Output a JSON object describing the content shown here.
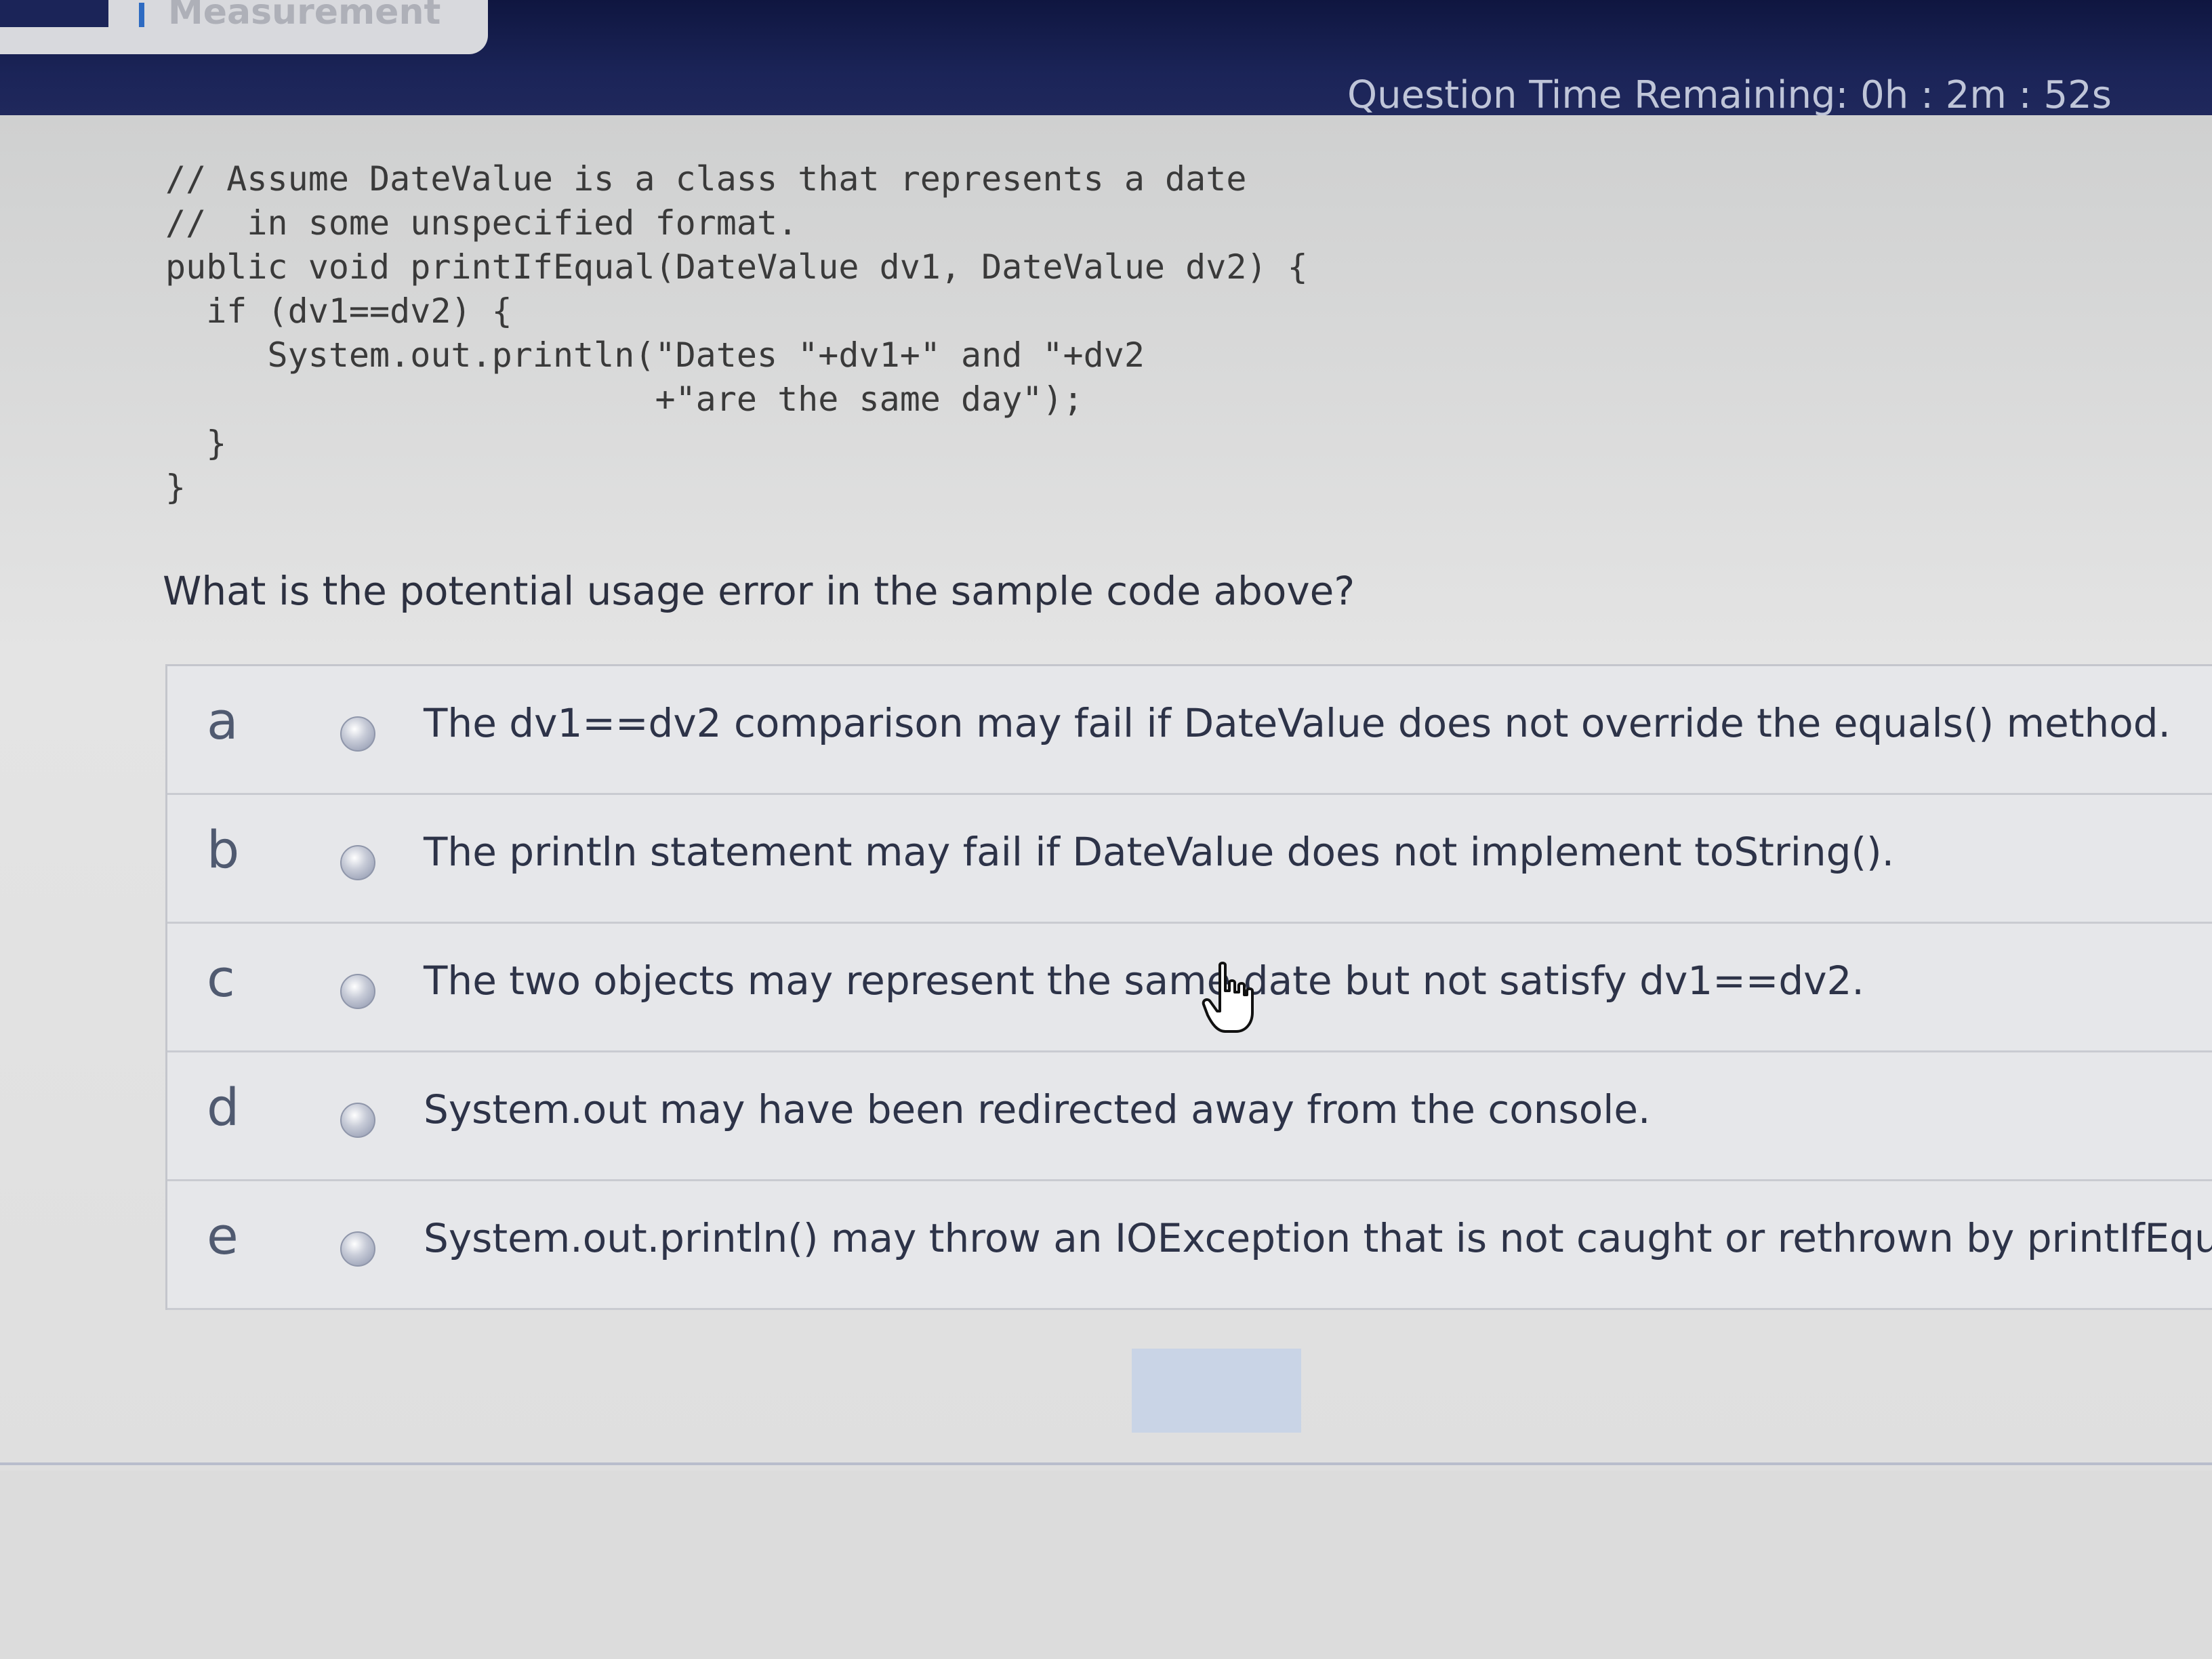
{
  "header": {
    "title": "Measurement",
    "timer_label": "Question Time Remaining:",
    "timer_hours": "0h",
    "timer_minutes": "2m",
    "timer_seconds": "52s",
    "timer_sep": ":"
  },
  "question": {
    "code_lines": [
      "// Assume DateValue is a class that represents a date",
      "//  in some unspecified format.",
      "public void printIfEqual(DateValue dv1, DateValue dv2) {",
      "  if (dv1==dv2) {",
      "     System.out.println(\"Dates \"+dv1+\" and \"+dv2",
      "                        +\"are the same day\");",
      "  }",
      "}"
    ],
    "prompt": "What is the potential usage error in the sample code above?"
  },
  "answers": [
    {
      "letter": "a",
      "text": "The dv1==dv2 comparison may fail if DateValue does not override the equals() method."
    },
    {
      "letter": "b",
      "text": "The println statement may fail if DateValue does not implement toString()."
    },
    {
      "letter": "c",
      "text": "The two objects may represent the same date but not satisfy dv1==dv2."
    },
    {
      "letter": "d",
      "text": "System.out may have been redirected away from the console."
    },
    {
      "letter": "e",
      "text": "System.out.println() may throw an IOException that is not caught or rethrown by printIfEqu"
    }
  ],
  "icons": {
    "cursor": "hand-pointer-icon",
    "radio": "radio-button-icon"
  },
  "colors": {
    "header_bg": "#1b2458",
    "timer_text": "#bfc5d8",
    "panel_bg": "#e6e7ea",
    "submit_button": "#c9d4e6"
  }
}
